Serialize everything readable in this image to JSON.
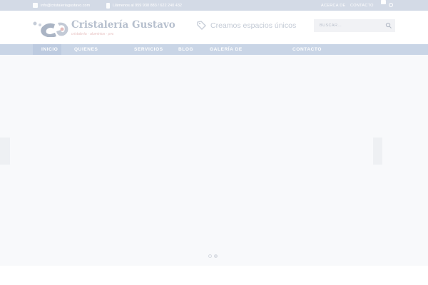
{
  "topbar": {
    "email": "info@cristaleriagustavo.com",
    "phone": "Llámenos al 959 938 883 / 622 240 432",
    "links": [
      "ACERCA DE",
      "CONTACTO"
    ],
    "social_icons": [
      "facebook-icon",
      "instagram-icon"
    ]
  },
  "header": {
    "logo_title": "Cristalería Gustavo",
    "logo_subtitle": "cristalería · aluminios · pvc",
    "slogan": "Creamos espacios únicos",
    "search_placeholder": "BUSCAR..."
  },
  "nav": {
    "items": [
      "INICIO",
      "QUIENES",
      "SERVICIOS",
      "BLOG",
      "GALERÍA DE",
      "CONTACTO"
    ],
    "active": "INICIO"
  },
  "slider": {
    "slide_count": 2,
    "active_index": 1
  },
  "colors": {
    "topbar_bg": "#d3dae6",
    "nav_bg": "#c9d5e6",
    "hero_bg": "#f8f9fb",
    "accent": "#bdcbe0"
  }
}
